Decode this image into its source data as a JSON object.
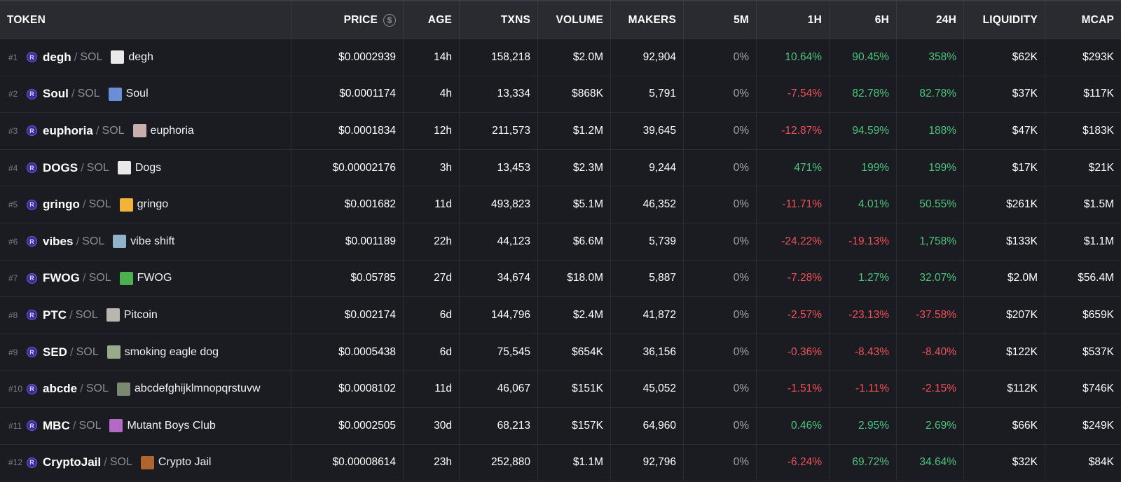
{
  "headers": {
    "token": "TOKEN",
    "price": "PRICE",
    "age": "AGE",
    "txns": "TXNS",
    "volume": "VOLUME",
    "makers": "MAKERS",
    "m5": "5M",
    "h1": "1H",
    "h6": "6H",
    "h24": "24H",
    "liquidity": "LIQUIDITY",
    "mcap": "MCAP"
  },
  "price_icon": "$",
  "dex_icon": "R",
  "colors": {
    "positive": "#4cc47d",
    "negative": "#f0505a",
    "neutral": "#9fa2ac"
  },
  "rows": [
    {
      "rank": "#1",
      "symbol": "degh",
      "quote": "SOL",
      "name": "degh",
      "avatar": "#e9e9e9",
      "price": "$0.0002939",
      "age": "14h",
      "txns": "158,218",
      "volume": "$2.0M",
      "makers": "92,904",
      "m5": "0%",
      "h1": "10.64%",
      "h6": "90.45%",
      "h24": "358%",
      "liquidity": "$62K",
      "mcap": "$293K"
    },
    {
      "rank": "#2",
      "symbol": "Soul",
      "quote": "SOL",
      "name": "Soul",
      "avatar": "#6a8fd8",
      "price": "$0.0001174",
      "age": "4h",
      "txns": "13,334",
      "volume": "$868K",
      "makers": "5,791",
      "m5": "0%",
      "h1": "-7.54%",
      "h6": "82.78%",
      "h24": "82.78%",
      "liquidity": "$37K",
      "mcap": "$117K"
    },
    {
      "rank": "#3",
      "symbol": "euphoria",
      "quote": "SOL",
      "name": "euphoria",
      "avatar": "#c9aeb0",
      "price": "$0.0001834",
      "age": "12h",
      "txns": "211,573",
      "volume": "$1.2M",
      "makers": "39,645",
      "m5": "0%",
      "h1": "-12.87%",
      "h6": "94.59%",
      "h24": "188%",
      "liquidity": "$47K",
      "mcap": "$183K"
    },
    {
      "rank": "#4",
      "symbol": "DOGS",
      "quote": "SOL",
      "name": "Dogs",
      "avatar": "#e8e8e8",
      "price": "$0.00002176",
      "age": "3h",
      "txns": "13,453",
      "volume": "$2.3M",
      "makers": "9,244",
      "m5": "0%",
      "h1": "471%",
      "h6": "199%",
      "h24": "199%",
      "liquidity": "$17K",
      "mcap": "$21K"
    },
    {
      "rank": "#5",
      "symbol": "gringo",
      "quote": "SOL",
      "name": "gringo",
      "avatar": "#f2b33a",
      "price": "$0.001682",
      "age": "11d",
      "txns": "493,823",
      "volume": "$5.1M",
      "makers": "46,352",
      "m5": "0%",
      "h1": "-11.71%",
      "h6": "4.01%",
      "h24": "50.55%",
      "liquidity": "$261K",
      "mcap": "$1.5M"
    },
    {
      "rank": "#6",
      "symbol": "vibes",
      "quote": "SOL",
      "name": "vibe shift",
      "avatar": "#8fb4c9",
      "price": "$0.001189",
      "age": "22h",
      "txns": "44,123",
      "volume": "$6.6M",
      "makers": "5,739",
      "m5": "0%",
      "h1": "-24.22%",
      "h6": "-19.13%",
      "h24": "1,758%",
      "liquidity": "$133K",
      "mcap": "$1.1M"
    },
    {
      "rank": "#7",
      "symbol": "FWOG",
      "quote": "SOL",
      "name": "FWOG",
      "avatar": "#4caf50",
      "price": "$0.05785",
      "age": "27d",
      "txns": "34,674",
      "volume": "$18.0M",
      "makers": "5,887",
      "m5": "0%",
      "h1": "-7.28%",
      "h6": "1.27%",
      "h24": "32.07%",
      "liquidity": "$2.0M",
      "mcap": "$56.4M"
    },
    {
      "rank": "#8",
      "symbol": "PTC",
      "quote": "SOL",
      "name": "Pitcoin",
      "avatar": "#b9b6b0",
      "price": "$0.002174",
      "age": "6d",
      "txns": "144,796",
      "volume": "$2.4M",
      "makers": "41,872",
      "m5": "0%",
      "h1": "-2.57%",
      "h6": "-23.13%",
      "h24": "-37.58%",
      "liquidity": "$207K",
      "mcap": "$659K"
    },
    {
      "rank": "#9",
      "symbol": "SED",
      "quote": "SOL",
      "name": "smoking eagle dog",
      "avatar": "#9aa98a",
      "price": "$0.0005438",
      "age": "6d",
      "txns": "75,545",
      "volume": "$654K",
      "makers": "36,156",
      "m5": "0%",
      "h1": "-0.36%",
      "h6": "-8.43%",
      "h24": "-8.40%",
      "liquidity": "$122K",
      "mcap": "$537K"
    },
    {
      "rank": "#10",
      "symbol": "abcde",
      "quote": "SOL",
      "name": "abcdefghijklmnopqrstuvw",
      "avatar": "#7a8a70",
      "price": "$0.0008102",
      "age": "11d",
      "txns": "46,067",
      "volume": "$151K",
      "makers": "45,052",
      "m5": "0%",
      "h1": "-1.51%",
      "h6": "-1.11%",
      "h24": "-2.15%",
      "liquidity": "$112K",
      "mcap": "$746K"
    },
    {
      "rank": "#11",
      "symbol": "MBC",
      "quote": "SOL",
      "name": "Mutant Boys Club",
      "avatar": "#b46ac4",
      "price": "$0.0002505",
      "age": "30d",
      "txns": "68,213",
      "volume": "$157K",
      "makers": "64,960",
      "m5": "0%",
      "h1": "0.46%",
      "h6": "2.95%",
      "h24": "2.69%",
      "liquidity": "$66K",
      "mcap": "$249K"
    },
    {
      "rank": "#12",
      "symbol": "CryptoJail",
      "quote": "SOL",
      "name": "Crypto Jail",
      "avatar": "#b0642e",
      "price": "$0.00008614",
      "age": "23h",
      "txns": "252,880",
      "volume": "$1.1M",
      "makers": "92,796",
      "m5": "0%",
      "h1": "-6.24%",
      "h6": "69.72%",
      "h24": "34.64%",
      "liquidity": "$32K",
      "mcap": "$84K"
    }
  ]
}
